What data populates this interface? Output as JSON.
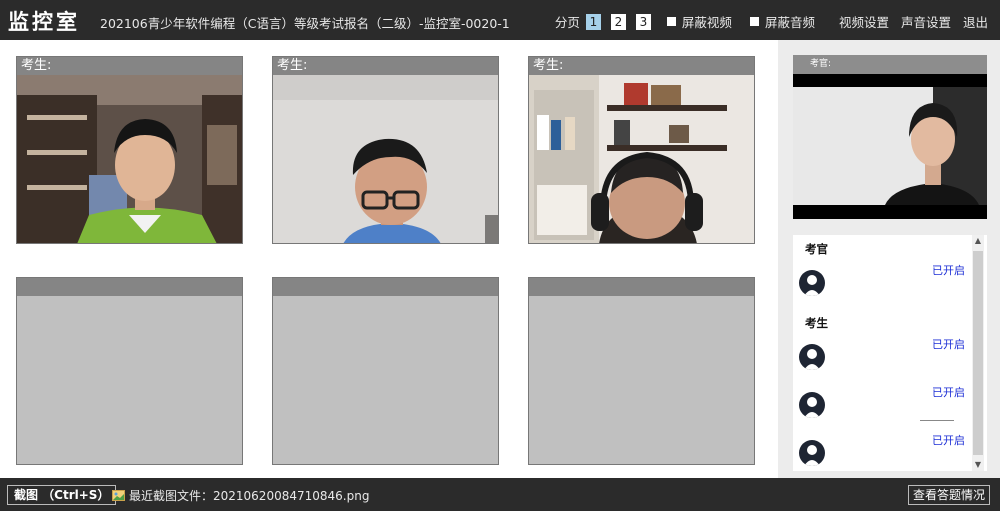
{
  "header": {
    "app_title": "监控室",
    "exam_title": "202106青少年软件编程（C语言）等级考试报名（二级）-监控室-0020-1",
    "pager_label": "分页",
    "pages": [
      "1",
      "2",
      "3"
    ],
    "active_page": "1",
    "mask_video_label": "屏蔽视频",
    "mask_audio_label": "屏蔽音频",
    "video_settings_label": "视频设置",
    "audio_settings_label": "声音设置",
    "logout_label": "退出"
  },
  "tiles": [
    {
      "label": "考生:",
      "has_video": true
    },
    {
      "label": "考生:",
      "has_video": true
    },
    {
      "label": "考生:",
      "has_video": true
    },
    {
      "label": "",
      "has_video": false
    },
    {
      "label": "",
      "has_video": false
    },
    {
      "label": "",
      "has_video": false
    }
  ],
  "sidebar": {
    "camera_label": "考官:",
    "examiner_section": "考官",
    "examinee_section": "考生",
    "rows": [
      {
        "status": "已开启"
      },
      {
        "status": "已开启"
      },
      {
        "status": "已开启"
      },
      {
        "status": "已开启"
      }
    ]
  },
  "footer": {
    "capture_button": "截图 （Ctrl+S）",
    "recent_label": "最近截图文件：20210620084710846.png",
    "answers_button": "查看答题情况"
  },
  "colors": {
    "header_bg": "#2b2b2b",
    "tile_head": "#858585",
    "tile_body": "#c0c0c0",
    "active_page": "#a6d1ea",
    "status_text": "#1d2fd6"
  }
}
